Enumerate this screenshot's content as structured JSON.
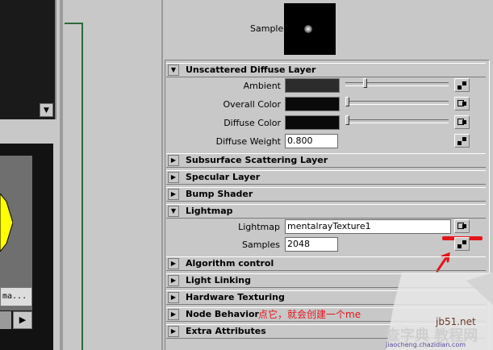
{
  "sample": {
    "label": "Sample"
  },
  "sections": [
    {
      "label": "Unscattered Diffuse Layer",
      "expanded": true
    },
    {
      "label": "Subsurface Scattering Layer",
      "expanded": false
    },
    {
      "label": "Specular Layer",
      "expanded": false
    },
    {
      "label": "Bump Shader",
      "expanded": false
    },
    {
      "label": "Lightmap",
      "expanded": true
    },
    {
      "label": "Algorithm control",
      "expanded": false
    },
    {
      "label": "Light Linking",
      "expanded": false
    },
    {
      "label": "Hardware Texturing",
      "expanded": false
    },
    {
      "label": "Node Behavior",
      "expanded": false
    },
    {
      "label": "Extra Attributes",
      "expanded": false
    }
  ],
  "diffuse": {
    "ambient_label": "Ambient",
    "overall_color_label": "Overall Color",
    "diffuse_color_label": "Diffuse Color",
    "diffuse_weight_label": "Diffuse Weight",
    "diffuse_weight_value": "0.800"
  },
  "lightmap": {
    "lightmap_label": "Lightmap",
    "lightmap_value": "mentalrayTexture1",
    "samples_label": "Samples",
    "samples_value": "2048"
  },
  "left": {
    "field_text": "ma..."
  },
  "annotation": "点它，就会创建一个me",
  "watermark": {
    "line1": "jb51.net",
    "line2": "查字典 教程网",
    "line3": "jiaocheng.chazidian.com"
  },
  "colors": {
    "accent_red": "#e3151b",
    "yellow": "#ffff00"
  }
}
